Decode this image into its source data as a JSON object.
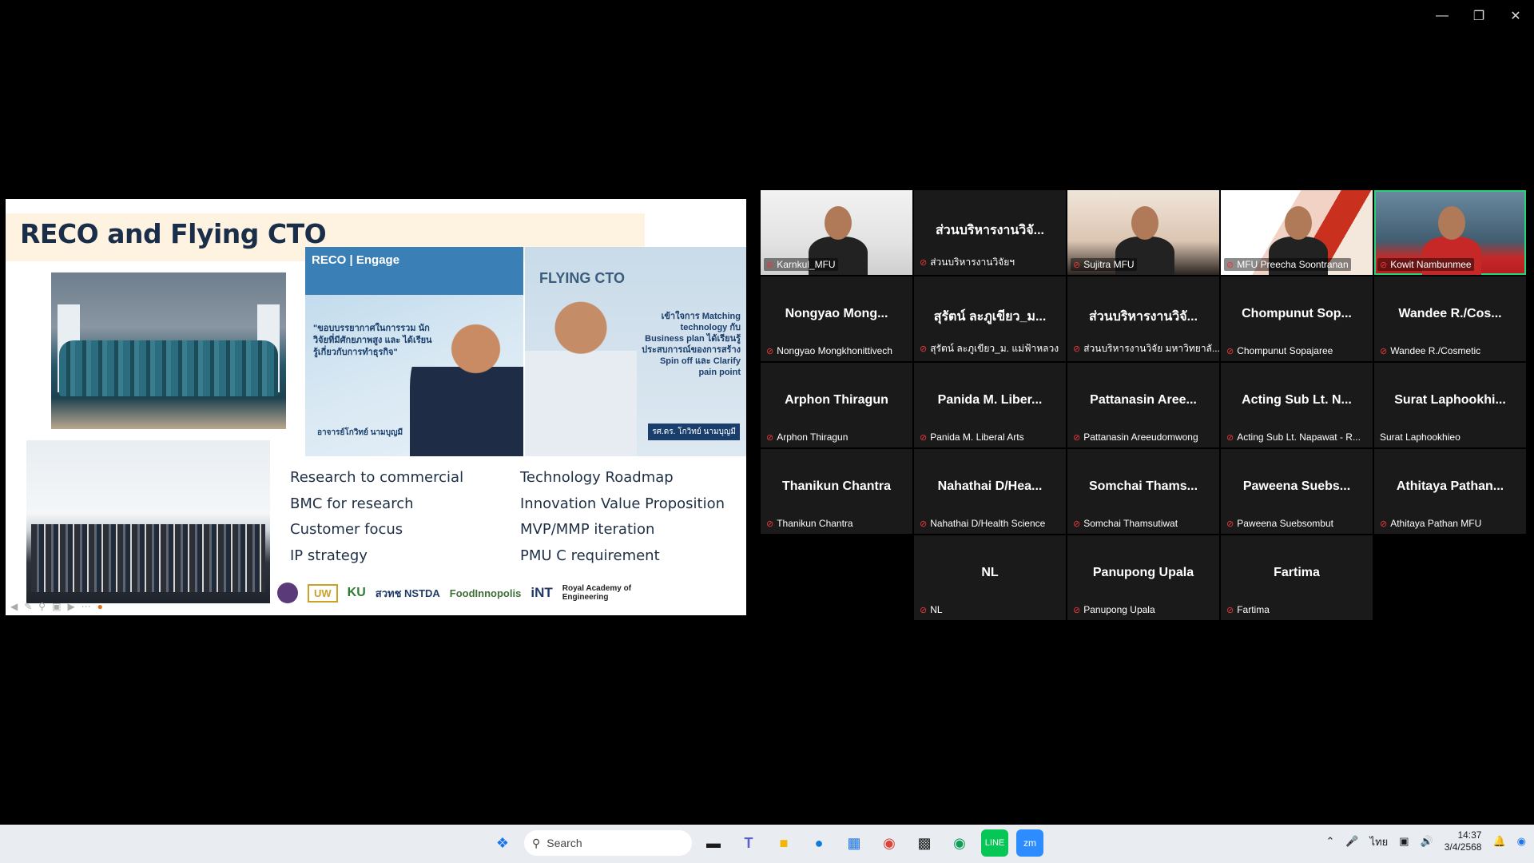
{
  "window": {
    "minimize": "—",
    "restore": "❐",
    "close": "✕"
  },
  "slide": {
    "title": "RECO and Flying CTO",
    "poster1": {
      "brand": "RECO | Engage",
      "quote": "\"ขอบบรรยากาศในการรวม นักวิจัยที่มีศักยภาพสูง และ ได้เรียนรู้เกี่ยวกับการทำธุรกิจ\"",
      "sig": "อาจารย์โกวิทย์ นามบุญมี"
    },
    "poster2": {
      "brand": "FLYING CTO",
      "text": "เข้าใจการ Matching technology กับ Business plan ได้เรียนรู้ ประสบการณ์ของการสร้าง Spin off และ Clarify pain point",
      "tag": "รศ.ดร. โกวิทย์ นามบุญมี"
    },
    "bullets_left": [
      "Research to commercial",
      "BMC for research",
      "Customer focus",
      "IP strategy"
    ],
    "bullets_right": [
      "Technology Roadmap",
      "Innovation Value Proposition",
      "MVP/MMP iteration",
      "PMU C requirement"
    ],
    "logos": [
      "UW",
      "KU",
      "สวทช NSTDA",
      "FoodInnopolis",
      "iNT",
      "Royal Academy of Engineering"
    ]
  },
  "participants": [
    {
      "name": "",
      "label": "Karnkul_MFU",
      "video": "v1"
    },
    {
      "name": "ส่วนบริหารงานวิจั...",
      "label": "ส่วนบริหารงานวิจัยฯ"
    },
    {
      "name": "",
      "label": "Sujitra MFU",
      "video": "v2"
    },
    {
      "name": "",
      "label": "MFU Preecha Soontranan",
      "video": "v3"
    },
    {
      "name": "",
      "label": "Kowit Nambunmee",
      "video": "v4",
      "active": true
    },
    {
      "name": "Nongyao Mong...",
      "label": "Nongyao Mongkhonittivech"
    },
    {
      "name": "สุรัตน์ ละภูเขียว_ม...",
      "label": "สุรัตน์ ละภูเขียว_ม. แม่ฟ้าหลวง"
    },
    {
      "name": "ส่วนบริหารงานวิจั...",
      "label": "ส่วนบริหารงานวิจัย มหาวิทยาลั..."
    },
    {
      "name": "Chompunut Sop...",
      "label": "Chompunut Sopajaree"
    },
    {
      "name": "Wandee R./Cos...",
      "label": "Wandee R./Cosmetic"
    },
    {
      "name": "Arphon Thiragun",
      "label": "Arphon Thiragun"
    },
    {
      "name": "Panida M. Liber...",
      "label": "Panida M. Liberal Arts"
    },
    {
      "name": "Pattanasin Aree...",
      "label": "Pattanasin Areeudomwong"
    },
    {
      "name": "Acting Sub Lt. N...",
      "label": "Acting Sub Lt. Napawat - R..."
    },
    {
      "name": "Surat Laphookhi...",
      "label": "Surat Laphookhieo",
      "nomic": true
    },
    {
      "name": "Thanikun Chantra",
      "label": "Thanikun Chantra"
    },
    {
      "name": "Nahathai D/Hea...",
      "label": "Nahathai D/Health Science"
    },
    {
      "name": "Somchai Thams...",
      "label": "Somchai Thamsutiwat"
    },
    {
      "name": "Paweena Suebs...",
      "label": "Paweena Suebsombut"
    },
    {
      "name": "Athitaya Pathan...",
      "label": "Athitaya Pathan MFU"
    },
    {
      "name": "NL",
      "label": "NL"
    },
    {
      "name": "Panupong Upala",
      "label": "Panupong Upala"
    },
    {
      "name": "Fartima",
      "label": "Fartima"
    }
  ],
  "taskbar": {
    "search_label": "Search",
    "apps": [
      "start-icon",
      "search",
      "task-view-icon",
      "teams-icon",
      "file-explorer-icon",
      "edge-icon",
      "store-icon",
      "chrome-icon",
      "files-icon",
      "chrome-icon-2",
      "line-icon",
      "zoom-icon"
    ],
    "lang": "ไทย",
    "time": "14:37",
    "date": "3/4/2568"
  }
}
